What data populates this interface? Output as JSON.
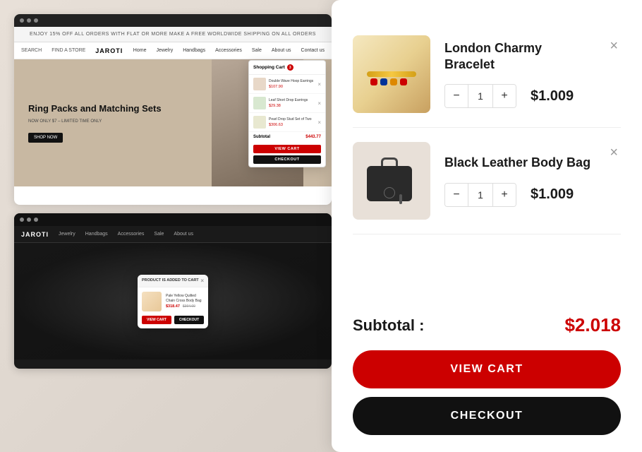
{
  "left_panel": {
    "top_screenshot": {
      "announcement": "ENJOY 15% OFF ALL ORDERS WITH FLAT OR MORE MAKE A FREE WORLDWIDE SHIPPING ON ALL ORDERS",
      "logo": "JAROTI",
      "search": "SEARCH",
      "find_store": "FIND A STORE",
      "nav_items": [
        "Home",
        "Jewelry",
        "Handbags",
        "Accessories",
        "Sale",
        "About us",
        "Contact us"
      ],
      "hero_title": "Ring Packs and Matching Sets",
      "hero_subtitle": "NOW ONLY $7 – LIMITED TIME ONLY",
      "hero_button": "SHOP NOW",
      "mini_cart": {
        "title": "Shopping Cart",
        "items": [
          {
            "name": "Double Wave Hoop Earrings",
            "price": "$107.90"
          },
          {
            "name": "Leaf Short Drop Earrings",
            "price": "$29.38"
          },
          {
            "name": "Pearl Drop Stud Set of Two",
            "price": "$306.63"
          }
        ],
        "subtotal_label": "Subtotal",
        "subtotal_value": "$443.77",
        "view_cart": "VIEW CART",
        "checkout": "CHECKOUT"
      }
    },
    "bottom_screenshot": {
      "logo": "JAROTI",
      "nav_items": [
        "Jewelry",
        "Handbags",
        "Accessories",
        "Sale",
        "About us"
      ],
      "popup": {
        "header": "PRODUCT IS ADDED TO CART",
        "product_name": "Pale Yellow Quilted Chain Cross Body Bag",
        "sale_price": "$318.47",
        "original_price": "$394.00",
        "view_cart": "VIEW CART",
        "checkout": "CHECKOUT"
      }
    }
  },
  "right_panel": {
    "items": [
      {
        "name": "London Charmy Bracelet",
        "quantity": 1,
        "price": "$1.009",
        "type": "bracelet"
      },
      {
        "name": "Black Leather Body Bag",
        "quantity": 1,
        "price": "$1.009",
        "type": "bag"
      }
    ],
    "subtotal_label": "Subtotal :",
    "subtotal_value": "$2.018",
    "view_cart_label": "VIEW CART",
    "checkout_label": "CHECKOUT"
  },
  "colors": {
    "primary_red": "#cc0000",
    "dark": "#111111",
    "light_gray": "#f5f5f5"
  }
}
